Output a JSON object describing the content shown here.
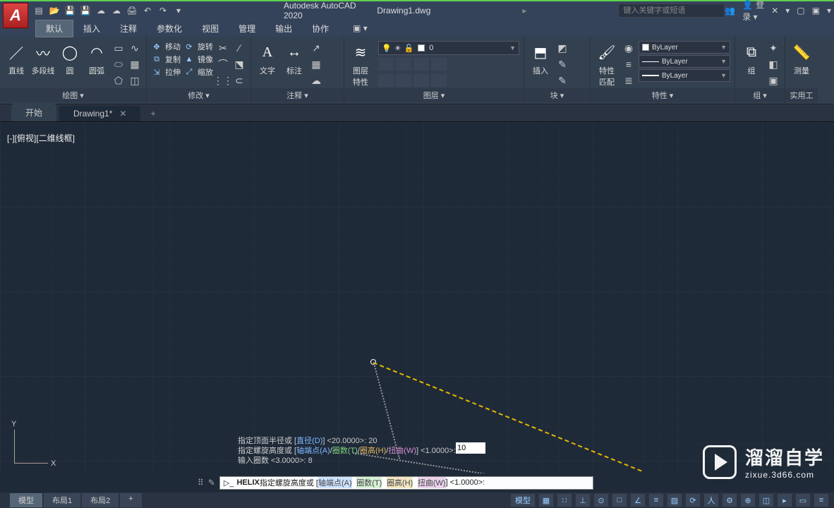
{
  "app": {
    "title": "Autodesk AutoCAD 2020",
    "file": "Drawing1.dwg",
    "search_placeholder": "键入关键字或短语",
    "login": "登录"
  },
  "menu": {
    "items": [
      "默认",
      "插入",
      "注释",
      "参数化",
      "视图",
      "管理",
      "输出",
      "协作"
    ],
    "active": 0
  },
  "ribbon": {
    "draw": {
      "line": "直线",
      "polyline": "多段线",
      "circle": "圆",
      "arc": "圆弧",
      "title": "绘图 ▾"
    },
    "modify": {
      "move": "移动",
      "copy": "复制",
      "stretch": "拉伸",
      "rotate": "旋转",
      "mirror": "镜像",
      "scale": "缩放",
      "title": "修改 ▾"
    },
    "annot": {
      "text": "文字",
      "dim": "标注",
      "title": "注释 ▾"
    },
    "layers": {
      "props": "图层\n特性",
      "combo": "0",
      "title": "图层 ▾"
    },
    "insert": {
      "label": "插入",
      "title": "块 ▾"
    },
    "props": {
      "label": "特性\n匹配",
      "bylayer": "ByLayer",
      "title": "特性 ▾"
    },
    "group": {
      "label": "组",
      "title": "组 ▾"
    },
    "util": {
      "label": "测量",
      "title": "实用工"
    }
  },
  "doctabs": {
    "start": "开始",
    "drawing": "Drawing1*",
    "close": "✕",
    "add": "+"
  },
  "canvas": {
    "view_label": "[-][俯视][二维线框]",
    "dyn_input": "10",
    "y": "Y",
    "x": "X"
  },
  "history": {
    "l1_a": "指定顶面半径或 [",
    "l1_b": "直径(D)",
    "l1_c": "] <20.0000>:  20",
    "l2_a": "指定螺旋高度或 [",
    "l2_b": "轴端点(A)",
    "l2_c": "圈数(T)",
    "l2_d": "圈高(H)",
    "l2_e": "扭曲(W)",
    "l2_f": "] <1.0000>:  t",
    "l3": "输入圈数 <3.0000>:  8"
  },
  "cmd": {
    "prefix": "HELIX ",
    "body": "指定螺旋高度或 [",
    "o1": "轴端点(A)",
    "o2": "圈数(T)",
    "o3": "圈高(H)",
    "o4": "扭曲(W)",
    "suffix": "] <1.0000>:"
  },
  "model_tabs": [
    "模型",
    "布局1",
    "布局2"
  ],
  "status_model": "模型",
  "watermark": {
    "big": "溜溜自学",
    "small": "zixue.3d66.com"
  }
}
